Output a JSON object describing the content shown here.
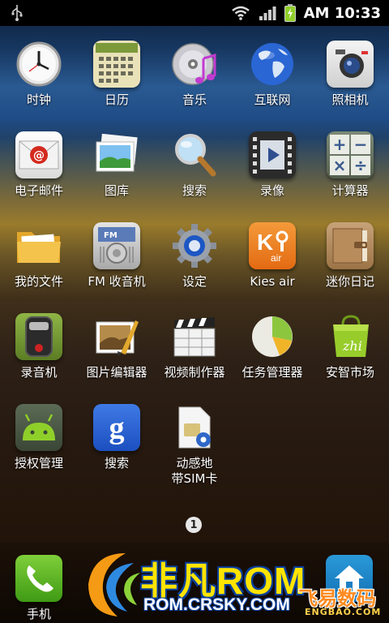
{
  "status": {
    "time": "AM 10:33"
  },
  "apps": [
    {
      "label": "时钟",
      "icon": "clock-icon"
    },
    {
      "label": "日历",
      "icon": "calendar-icon"
    },
    {
      "label": "音乐",
      "icon": "music-cd-icon"
    },
    {
      "label": "互联网",
      "icon": "globe-icon"
    },
    {
      "label": "照相机",
      "icon": "camera-icon"
    },
    {
      "label": "电子邮件",
      "icon": "email-icon"
    },
    {
      "label": "图库",
      "icon": "gallery-icon"
    },
    {
      "label": "搜索",
      "icon": "magnifier-icon"
    },
    {
      "label": "录像",
      "icon": "video-film-icon"
    },
    {
      "label": "计算器",
      "icon": "calculator-icon"
    },
    {
      "label": "我的文件",
      "icon": "folder-icon"
    },
    {
      "label": "FM 收音机",
      "icon": "radio-icon"
    },
    {
      "label": "设定",
      "icon": "gear-icon"
    },
    {
      "label": "Kies air",
      "icon": "kies-air-icon"
    },
    {
      "label": "迷你日记",
      "icon": "diary-icon"
    },
    {
      "label": "录音机",
      "icon": "voice-recorder-icon"
    },
    {
      "label": "图片编辑器",
      "icon": "photo-editor-icon"
    },
    {
      "label": "视频制作器",
      "icon": "clapperboard-icon"
    },
    {
      "label": "任务管理器",
      "icon": "pie-chart-icon"
    },
    {
      "label": "安智市场",
      "icon": "shopping-bag-icon"
    },
    {
      "label": "授权管理",
      "icon": "android-superuser-icon"
    },
    {
      "label": "搜索",
      "icon": "google-search-icon"
    },
    {
      "label": "动感地\n带SIM卡",
      "icon": "sim-card-icon"
    }
  ],
  "page_indicator": "1",
  "dock": [
    {
      "label": "手机",
      "icon": "phone-icon"
    },
    {
      "label": "",
      "icon": "home-icon"
    }
  ],
  "watermark": {
    "main": "非凡ROM",
    "url": "ROM.CRSKY.COM",
    "corner_text": "飞易数码",
    "corner_url": "ENGBAO.COM"
  },
  "colors": {
    "status_bar": "#000000",
    "battery": "#8fcf2a",
    "watermark_yellow": "#ffe400",
    "watermark_blue": "#0a3f9c"
  }
}
